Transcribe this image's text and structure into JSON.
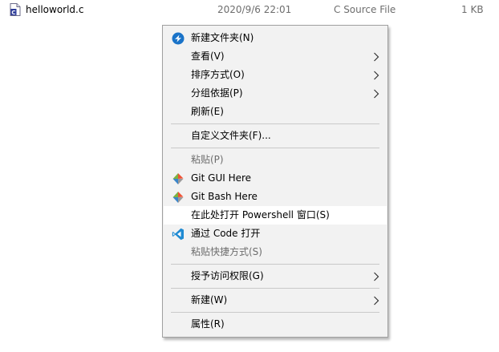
{
  "file": {
    "name": "helloworld.c",
    "date": "2020/9/6 22:01",
    "type": "C Source File",
    "size": "1 KB"
  },
  "menu": {
    "items": [
      {
        "label": "新建文件夹(N)",
        "icon": "new-folder-icon"
      },
      {
        "label": "查看(V)",
        "submenu": true
      },
      {
        "label": "排序方式(O)",
        "submenu": true
      },
      {
        "label": "分组依据(P)",
        "submenu": true
      },
      {
        "label": "刷新(E)"
      },
      {
        "label": "自定义文件夹(F)..."
      },
      {
        "label": "粘贴(P)",
        "disabled": true
      },
      {
        "label": "Git GUI Here",
        "icon": "git-icon"
      },
      {
        "label": "Git Bash Here",
        "icon": "git-icon"
      },
      {
        "label": "在此处打开 Powershell 窗口(S)",
        "highlighted": true
      },
      {
        "label": "通过 Code 打开",
        "icon": "vscode-icon"
      },
      {
        "label": "粘贴快捷方式(S)",
        "disabled": true
      },
      {
        "label": "授予访问权限(G)",
        "submenu": true
      },
      {
        "label": "新建(W)",
        "submenu": true
      },
      {
        "label": "属性(R)"
      }
    ]
  },
  "colors": {
    "menu_bg": "#f2f2f2",
    "highlight_bg": "#ffffff",
    "disabled_text": "#6d6d6d",
    "git_orange": "#f05133",
    "git_blue": "#3b85c9",
    "git_green": "#7cb342",
    "vscode_blue": "#1f8ad2",
    "folder_blue": "#1a73c8"
  }
}
